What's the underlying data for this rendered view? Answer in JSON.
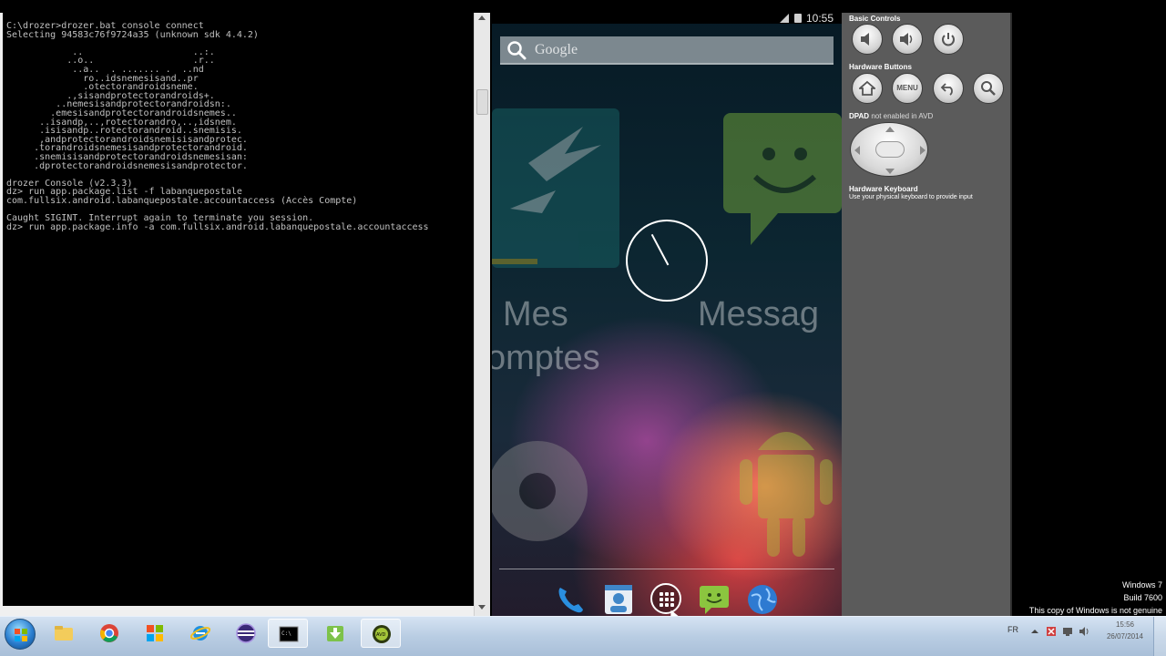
{
  "console": {
    "lines": [
      "C:\\drozer>drozer.bat console connect",
      "Selecting 94583c76f9724a35 (unknown sdk 4.4.2)",
      "",
      "            ..                    ..:.",
      "           ..o..                  .r..",
      "            ..a..  . ....... .  ..nd",
      "              ro..idsnemesisand..pr",
      "              .otectorandroidsneme.",
      "           .,sisandprotectorandroids+.",
      "         ..nemesisandprotectorandroidsn:.",
      "        .emesisandprotectorandroidsnemes..",
      "      ..isandp,..,rotectorandro,..,idsnem.",
      "      .isisandp..rotectorandroid..snemisis.",
      "      ,andprotectorandroidsnemisisandprotec.",
      "     .torandroidsnemesisandprotectorandroid.",
      "     .snemisisandprotectorandroidsnemesisan:",
      "     .dprotectorandroidsnemesisandprotector.",
      "",
      "drozer Console (v2.3.3)",
      "dz> run app.package.list -f labanquepostale",
      "com.fullsix.android.labanquepostale.accountaccess (Accès Compte)",
      "",
      "Caught SIGINT. Interrupt again to terminate you session.",
      "dz> run app.package.info -a com.fullsix.android.labanquepostale.accountaccess"
    ]
  },
  "emulator": {
    "status_time": "10:55",
    "search_label": "Google",
    "home_labels": {
      "left_top": "Mes",
      "left_bottom": "omptes",
      "right": "Messag"
    },
    "dock": [
      {
        "name": "phone-icon",
        "color": "#2a8fe0"
      },
      {
        "name": "contacts-icon",
        "color": "#3f86c8"
      },
      {
        "name": "apps-icon",
        "color": "#ffffff"
      },
      {
        "name": "messaging-icon",
        "color": "#8bc53f"
      },
      {
        "name": "browser-icon",
        "color": "#2e7ad1"
      }
    ]
  },
  "controls": {
    "basic_controls": "Basic Controls",
    "hardware_buttons": "Hardware Buttons",
    "menu_label": "MENU",
    "dpad_label": "DPAD",
    "dpad_note": "not enabled in AVD",
    "hardware_keyboard": "Hardware Keyboard",
    "keyboard_note": "Use your physical keyboard to provide input"
  },
  "watermark": {
    "line1": "Windows 7",
    "line2": "Build 7600",
    "line3": "This copy of Windows is not genuine"
  },
  "taskbar": {
    "lang": "FR",
    "time": "15:56",
    "date": "26/07/2014",
    "apps": [
      "explorer",
      "chrome",
      "windows-media",
      "internet-explorer",
      "eclipse",
      "cmd",
      "installer",
      "android-avd"
    ]
  }
}
